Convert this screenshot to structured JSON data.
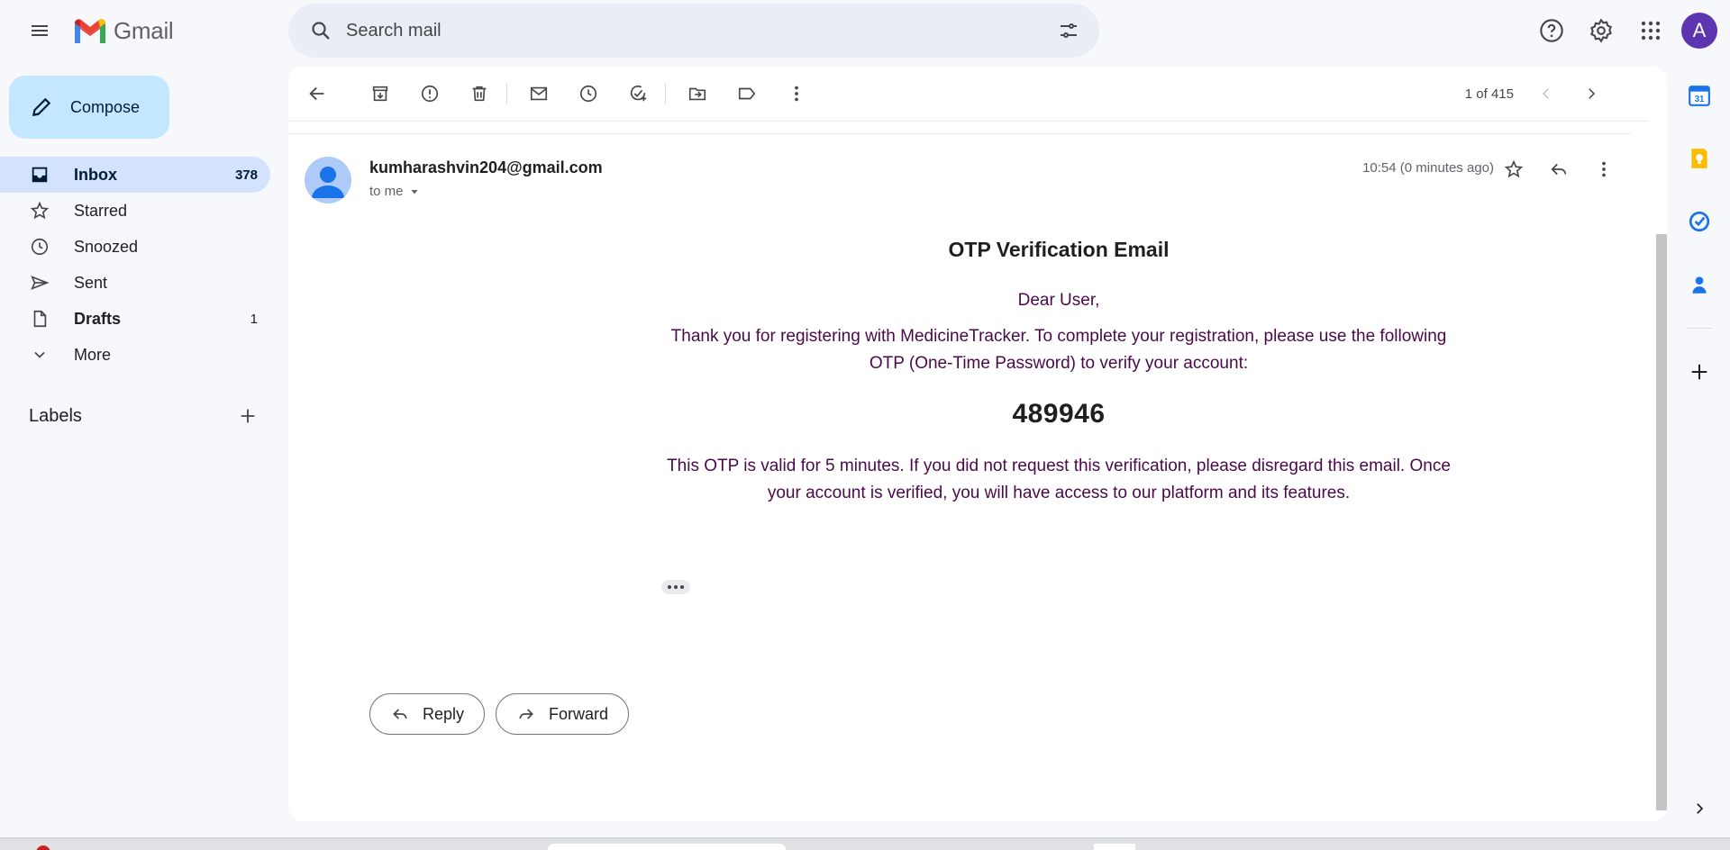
{
  "app": {
    "name": "Gmail"
  },
  "search": {
    "placeholder": "Search mail"
  },
  "user": {
    "avatar_letter": "A"
  },
  "compose": {
    "label": "Compose"
  },
  "nav": {
    "items": [
      {
        "label": "Inbox",
        "count": "378",
        "icon": "inbox-icon"
      },
      {
        "label": "Starred",
        "count": "",
        "icon": "star-icon"
      },
      {
        "label": "Snoozed",
        "count": "",
        "icon": "clock-icon"
      },
      {
        "label": "Sent",
        "count": "",
        "icon": "send-icon"
      },
      {
        "label": "Drafts",
        "count": "1",
        "icon": "draft-icon"
      },
      {
        "label": "More",
        "count": "",
        "icon": "chevron-down-icon"
      }
    ],
    "labels_heading": "Labels"
  },
  "pager": {
    "text": "1 of 415"
  },
  "message": {
    "sender": "kumharashvin204@gmail.com",
    "to": "to me",
    "time": "10:54 (0 minutes ago)",
    "title": "OTP Verification Email",
    "greeting": "Dear User,",
    "paragraph1": "Thank you for registering with MedicineTracker. To complete your registration, please use the following OTP (One-Time Password) to verify your account:",
    "otp": "489946",
    "paragraph2": "This OTP is valid for 5 minutes. If you did not request this verification, please disregard this email. Once your account is verified, you will have access to our platform and its features."
  },
  "actions": {
    "reply": "Reply",
    "forward": "Forward"
  },
  "side_panel": {
    "calendar_day": "31"
  },
  "colors": {
    "accent": "#0b57d0",
    "compose_bg": "#c2e7ff",
    "active_nav": "#d3e3fd",
    "avatar": "#5e35b1",
    "body_text": "#4a0a4a"
  }
}
